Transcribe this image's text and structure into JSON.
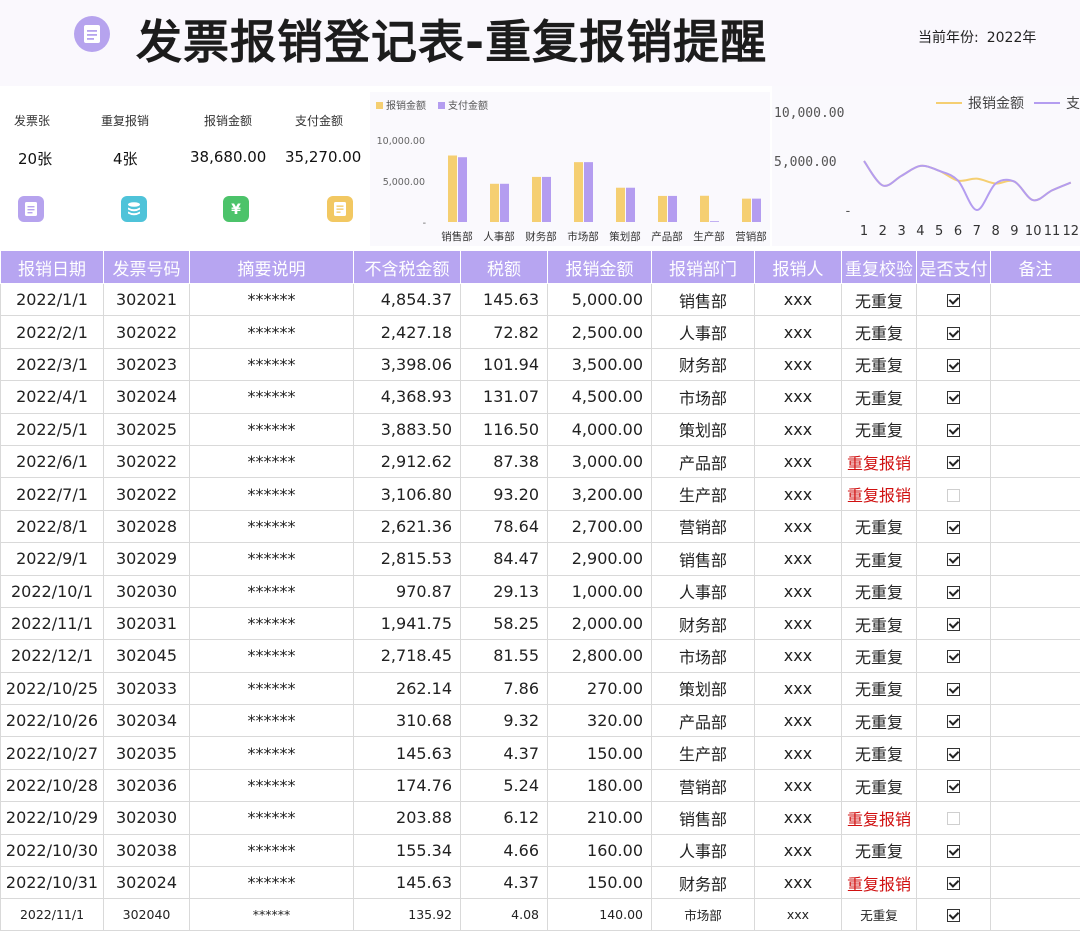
{
  "header": {
    "title": "发票报销登记表-重复报销提醒",
    "year_label": "当前年份:",
    "year_value": "2022年"
  },
  "kpis": [
    {
      "label": "发票张",
      "value": "20张",
      "icon": "document-icon",
      "color": "#b6a3ee"
    },
    {
      "label": "重复报销",
      "value": "4张",
      "icon": "database-icon",
      "color": "#4fc3d9"
    },
    {
      "label": "报销金额",
      "value": "38,680.00",
      "icon": "yen-icon",
      "color": "#4cc36a"
    },
    {
      "label": "支付金额",
      "value": "35,270.00",
      "icon": "note-icon",
      "color": "#f2c862"
    }
  ],
  "chart_data": [
    {
      "type": "bar",
      "categories": [
        "销售部",
        "人事部",
        "财务部",
        "市场部",
        "策划部",
        "产品部",
        "生产部",
        "营销部"
      ],
      "series": [
        {
          "name": "报销金额",
          "color": "#f5cf72",
          "values": [
            8110,
            4660,
            5500,
            7300,
            4180,
            3180,
            3200,
            2850
          ]
        },
        {
          "name": "支付金额",
          "color": "#b49df0",
          "values": [
            7900,
            4660,
            5500,
            7300,
            4180,
            3180,
            0,
            2850
          ]
        }
      ],
      "y_ticks": [
        "10,000.00",
        "5,000.00",
        "-"
      ],
      "ylim": [
        0,
        10000
      ],
      "legend": "top-left"
    },
    {
      "type": "line",
      "x": [
        "1",
        "2",
        "3",
        "4",
        "5",
        "6",
        "7",
        "8",
        "9",
        "10",
        "11",
        "12"
      ],
      "series": [
        {
          "name": "报销金额",
          "color": "#f5cf72",
          "values": [
            5000,
            2500,
            3500,
            4500,
            4000,
            3000,
            3200,
            2700,
            2900,
            1000,
            2000,
            2800
          ]
        },
        {
          "name": "支付金额",
          "color": "#b49df0",
          "values": [
            5000,
            2500,
            3500,
            4500,
            4000,
            3000,
            0,
            2700,
            2900,
            1000,
            2000,
            2800
          ]
        }
      ],
      "y_ticks": [
        "10,000.00",
        "5,000.00",
        "-"
      ],
      "ylim": [
        0,
        10000
      ],
      "legend": "top-right",
      "legend_labels": [
        "报销金额",
        "支"
      ]
    }
  ],
  "table": {
    "columns": [
      "报销日期",
      "发票号码",
      "摘要说明",
      "不含税金额",
      "税额",
      "报销金额",
      "报销部门",
      "报销人",
      "重复校验",
      "是否支付",
      "备注"
    ],
    "rows": [
      [
        "2022/1/1",
        "302021",
        "******",
        "4,854.37",
        "145.63",
        "5,000.00",
        "销售部",
        "xxx",
        "无重复",
        true,
        ""
      ],
      [
        "2022/2/1",
        "302022",
        "******",
        "2,427.18",
        "72.82",
        "2,500.00",
        "人事部",
        "xxx",
        "无重复",
        true,
        ""
      ],
      [
        "2022/3/1",
        "302023",
        "******",
        "3,398.06",
        "101.94",
        "3,500.00",
        "财务部",
        "xxx",
        "无重复",
        true,
        ""
      ],
      [
        "2022/4/1",
        "302024",
        "******",
        "4,368.93",
        "131.07",
        "4,500.00",
        "市场部",
        "xxx",
        "无重复",
        true,
        ""
      ],
      [
        "2022/5/1",
        "302025",
        "******",
        "3,883.50",
        "116.50",
        "4,000.00",
        "策划部",
        "xxx",
        "无重复",
        true,
        ""
      ],
      [
        "2022/6/1",
        "302022",
        "******",
        "2,912.62",
        "87.38",
        "3,000.00",
        "产品部",
        "xxx",
        "重复报销",
        true,
        ""
      ],
      [
        "2022/7/1",
        "302022",
        "******",
        "3,106.80",
        "93.20",
        "3,200.00",
        "生产部",
        "xxx",
        "重复报销",
        false,
        ""
      ],
      [
        "2022/8/1",
        "302028",
        "******",
        "2,621.36",
        "78.64",
        "2,700.00",
        "营销部",
        "xxx",
        "无重复",
        true,
        ""
      ],
      [
        "2022/9/1",
        "302029",
        "******",
        "2,815.53",
        "84.47",
        "2,900.00",
        "销售部",
        "xxx",
        "无重复",
        true,
        ""
      ],
      [
        "2022/10/1",
        "302030",
        "******",
        "970.87",
        "29.13",
        "1,000.00",
        "人事部",
        "xxx",
        "无重复",
        true,
        ""
      ],
      [
        "2022/11/1",
        "302031",
        "******",
        "1,941.75",
        "58.25",
        "2,000.00",
        "财务部",
        "xxx",
        "无重复",
        true,
        ""
      ],
      [
        "2022/12/1",
        "302045",
        "******",
        "2,718.45",
        "81.55",
        "2,800.00",
        "市场部",
        "xxx",
        "无重复",
        true,
        ""
      ],
      [
        "2022/10/25",
        "302033",
        "******",
        "262.14",
        "7.86",
        "270.00",
        "策划部",
        "xxx",
        "无重复",
        true,
        ""
      ],
      [
        "2022/10/26",
        "302034",
        "******",
        "310.68",
        "9.32",
        "320.00",
        "产品部",
        "xxx",
        "无重复",
        true,
        ""
      ],
      [
        "2022/10/27",
        "302035",
        "******",
        "145.63",
        "4.37",
        "150.00",
        "生产部",
        "xxx",
        "无重复",
        true,
        ""
      ],
      [
        "2022/10/28",
        "302036",
        "******",
        "174.76",
        "5.24",
        "180.00",
        "营销部",
        "xxx",
        "无重复",
        true,
        ""
      ],
      [
        "2022/10/29",
        "302030",
        "******",
        "203.88",
        "6.12",
        "210.00",
        "销售部",
        "xxx",
        "重复报销",
        false,
        ""
      ],
      [
        "2022/10/30",
        "302038",
        "******",
        "155.34",
        "4.66",
        "160.00",
        "人事部",
        "xxx",
        "无重复",
        true,
        ""
      ],
      [
        "2022/10/31",
        "302024",
        "******",
        "145.63",
        "4.37",
        "150.00",
        "财务部",
        "xxx",
        "重复报销",
        true,
        ""
      ],
      [
        "2022/11/1",
        "302040",
        "******",
        "135.92",
        "4.08",
        "140.00",
        "市场部",
        "xxx",
        "无重复",
        true,
        ""
      ]
    ]
  }
}
